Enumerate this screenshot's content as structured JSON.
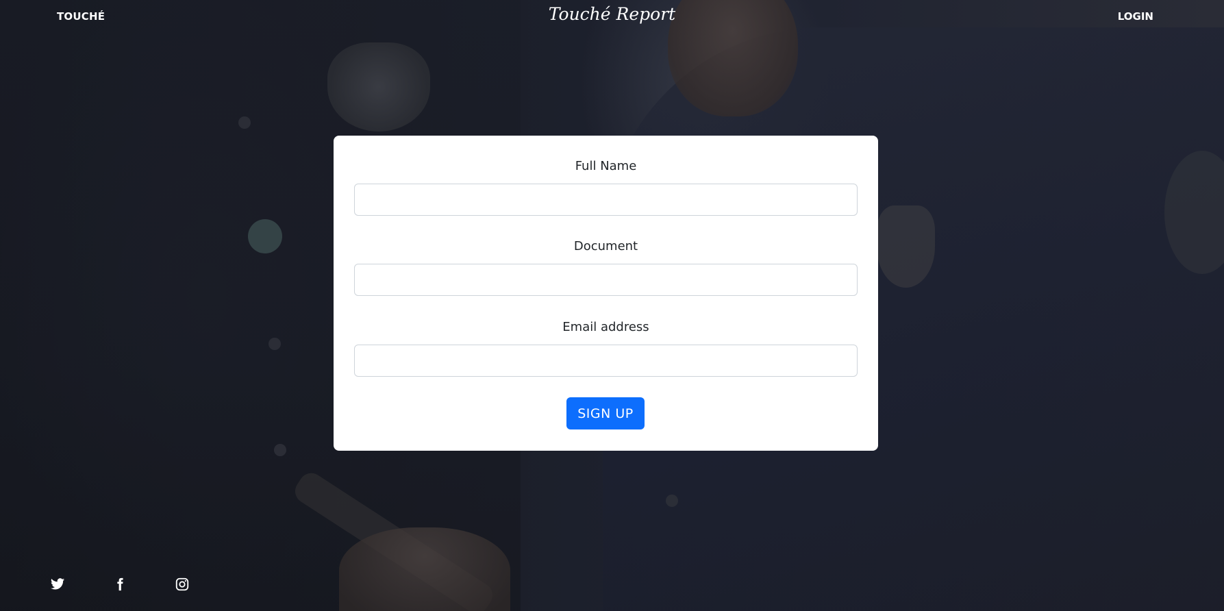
{
  "header": {
    "brand": "TOUCHÉ",
    "title": "Touché Report",
    "login_label": "LOGIN"
  },
  "form": {
    "fields": [
      {
        "label": "Full Name",
        "value": "",
        "placeholder": ""
      },
      {
        "label": "Document",
        "value": "",
        "placeholder": ""
      },
      {
        "label": "Email address",
        "value": "",
        "placeholder": ""
      }
    ],
    "submit_label": "SIGN UP"
  },
  "social": {
    "icons": [
      "twitter-icon",
      "facebook-icon",
      "instagram-icon"
    ]
  },
  "colors": {
    "accent": "#0d6efd",
    "card_background": "#ffffff",
    "header_text": "#ffffff",
    "label_text": "#212529"
  }
}
